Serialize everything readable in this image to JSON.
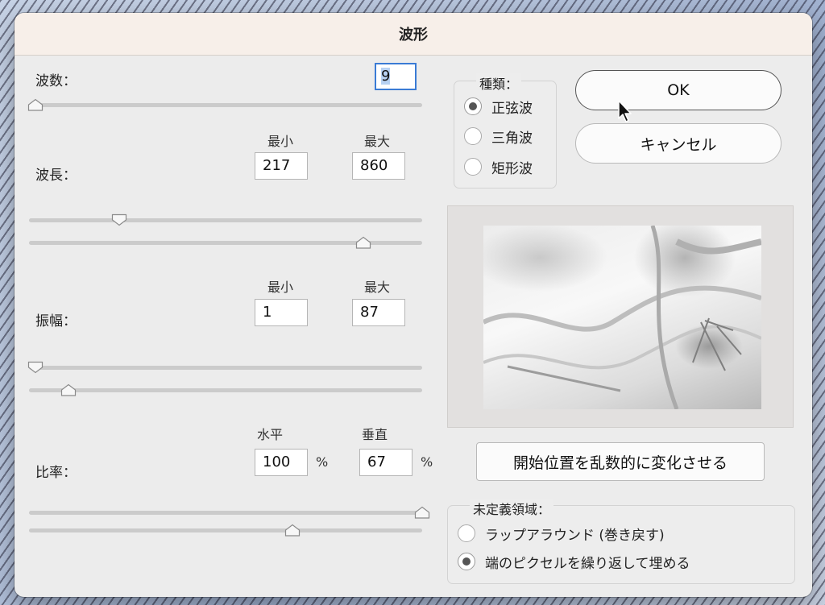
{
  "dialog": {
    "title": "波形"
  },
  "generators": {
    "label": "波数：",
    "value": "9",
    "slider_level": 0.0
  },
  "wavelength": {
    "label": "波長：",
    "min_label": "最小",
    "max_label": "最大",
    "min_value": "217",
    "max_value": "860",
    "min_slider_level": 0.23,
    "max_slider_level": 0.85
  },
  "amplitude": {
    "label": "振幅：",
    "min_label": "最小",
    "max_label": "最大",
    "min_value": "1",
    "max_value": "87",
    "min_slider_level": 0.0,
    "max_slider_level": 0.1
  },
  "scale": {
    "label": "比率：",
    "horiz_label": "水平",
    "vert_label": "垂直",
    "horiz_value": "100",
    "vert_value": "67",
    "unit": "%",
    "horiz_slider_level": 1.0,
    "vert_slider_level": 0.67
  },
  "type": {
    "title": "種類：",
    "options": [
      {
        "label": "正弦波",
        "selected": true
      },
      {
        "label": "三角波",
        "selected": false
      },
      {
        "label": "矩形波",
        "selected": false
      }
    ]
  },
  "buttons": {
    "ok": "OK",
    "cancel": "キャンセル",
    "randomize": "開始位置を乱数的に変化させる"
  },
  "undefined_areas": {
    "title": "未定義領域：",
    "options": [
      {
        "label": "ラップアラウンド (巻き戻す)",
        "selected": false
      },
      {
        "label": "端のピクセルを繰り返して埋める",
        "selected": true
      }
    ]
  },
  "colors": {
    "focus_ring": "#3a7bd5",
    "dialog_bg": "#ececec",
    "title_bg": "#f7efe9"
  }
}
